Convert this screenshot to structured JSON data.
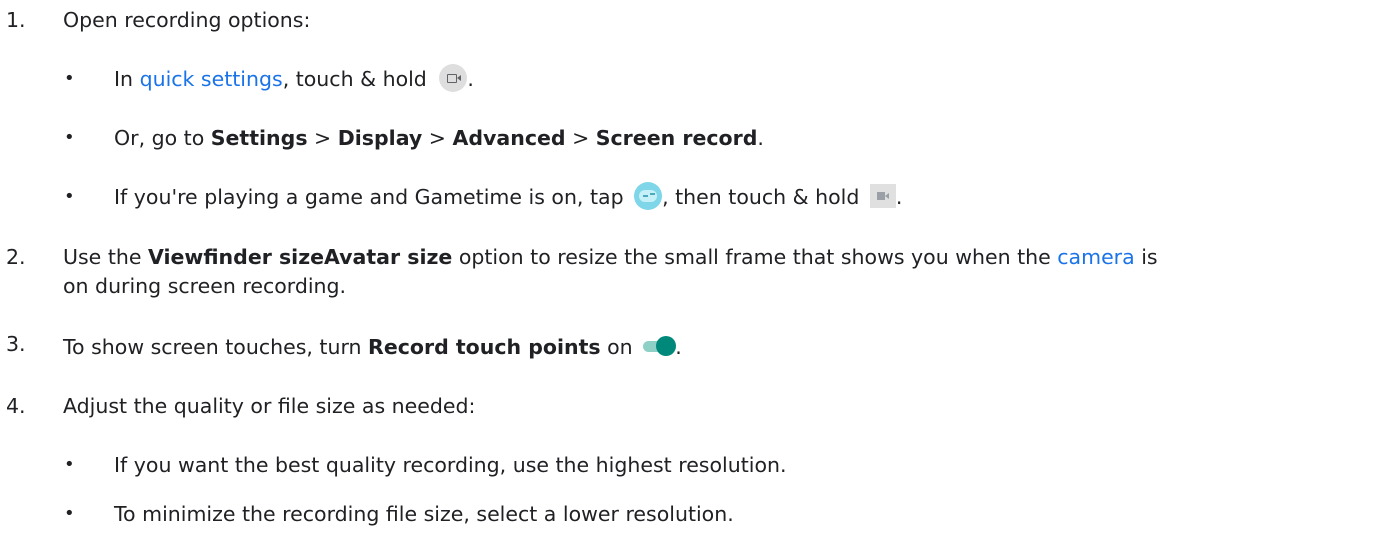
{
  "steps": [
    {
      "number": "1.",
      "text": "Open recording options:",
      "bullets": [
        {
          "prefix": "In ",
          "link": "quick settings",
          "middle": ", touch & hold ",
          "icon": "screen-record-icon",
          "suffix": "."
        },
        {
          "parts": [
            "Or, go to ",
            "Settings",
            " > ",
            "Display",
            " > ",
            "Advanced",
            " > ",
            "Screen record",
            "."
          ]
        },
        {
          "prefix": "If you're playing a game and Gametime is on, tap ",
          "icon1": "gametime-icon",
          "middle": ", then touch & hold ",
          "icon2": "record-video-icon",
          "suffix": "."
        }
      ]
    },
    {
      "number": "2.",
      "line1_prefix": "Use the ",
      "line1_bold": "Viewfinder sizeAvatar size",
      "line1_middle": " option to resize the small frame that shows you when the ",
      "line1_link": "camera",
      "line1_suffix": " is",
      "line2": "on during screen recording."
    },
    {
      "number": "3.",
      "prefix": "To show screen touches, turn ",
      "bold": "Record touch points",
      "middle": " on ",
      "icon": "toggle-on-icon",
      "suffix": "."
    },
    {
      "number": "4.",
      "text": "Adjust the quality or file size as needed:",
      "bullets": [
        "If you want the best quality recording, use the highest resolution.",
        "To minimize the recording file size, select a lower resolution."
      ]
    }
  ],
  "bullet_char": "•",
  "colors": {
    "text": "#202124",
    "link": "#1a73e8",
    "toggle": "#00897b",
    "gametime": "#7fd6e8"
  }
}
